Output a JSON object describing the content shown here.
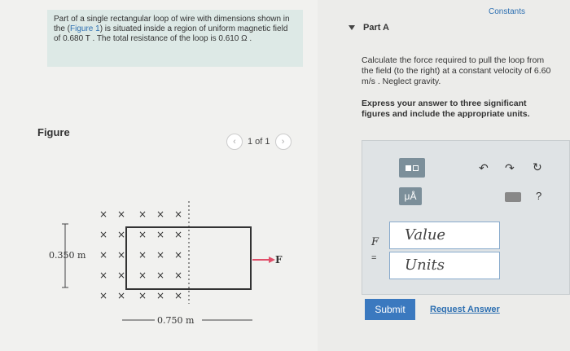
{
  "problem": {
    "part1": "Part of a single rectangular loop of wire with dimensions shown in the (",
    "figure_link": "Figure 1",
    "part2": ") is situated inside a region of uniform magnetic field of 0.680 T . The total resistance of the loop is 0.610 Ω ."
  },
  "figure": {
    "label": "Figure",
    "pager_text": "1 of 1",
    "height_label": "0.350 m",
    "width_label": "0.750 m",
    "force_label": "F",
    "field_symbol": "×"
  },
  "constants_link": "Constants",
  "part": {
    "title": "Part A",
    "question": "Calculate the force required to pull the loop from the field (to the right) at a constant velocity of 6.60 m/s . Neglect gravity.",
    "instructions": "Express your answer to three significant figures and include the appropriate units."
  },
  "answer": {
    "variable": "F",
    "equals": "=",
    "value_placeholder": "Value",
    "units_placeholder": "Units",
    "mu_label": "μÅ",
    "help_label": "?"
  },
  "buttons": {
    "submit": "Submit",
    "request": "Request Answer"
  },
  "colors": {
    "accent": "#3b79bf",
    "arrow": "#e0506a",
    "toolbar": "#7c8f9a"
  }
}
